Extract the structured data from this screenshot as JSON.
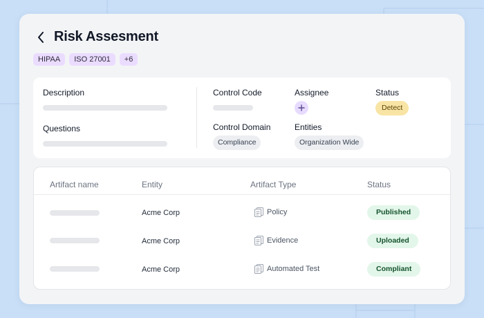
{
  "page": {
    "title": "Risk Assesment",
    "tags": [
      "HIPAA",
      "ISO 27001",
      "+6"
    ]
  },
  "info": {
    "description_label": "Description",
    "questions_label": "Questions",
    "control_code_label": "Control Code",
    "assignee_label": "Assignee",
    "status_label": "Status",
    "status_value": "Detect",
    "control_domain_label": "Control Domain",
    "control_domain_value": "Compliance",
    "entities_label": "Entities",
    "entities_value": "Organization Wide"
  },
  "table": {
    "headers": [
      "Artifact name",
      "Entity",
      "Artifact Type",
      "Status"
    ],
    "rows": [
      {
        "entity": "Acme Corp",
        "type": "Policy",
        "status": "Published"
      },
      {
        "entity": "Acme Corp",
        "type": "Evidence",
        "status": "Uploaded"
      },
      {
        "entity": "Acme Corp",
        "type": "Automated Test",
        "status": "Compliant"
      }
    ]
  },
  "colors": {
    "background": "#c9dff7",
    "tag_bg": "#eadcff",
    "detect_bg": "#f8e4a4",
    "status_pill_bg": "#e3f6ea"
  },
  "icons": {
    "back": "chevron-left-icon",
    "assignee_add": "plus-icon",
    "artifact_type": "document-icon"
  }
}
